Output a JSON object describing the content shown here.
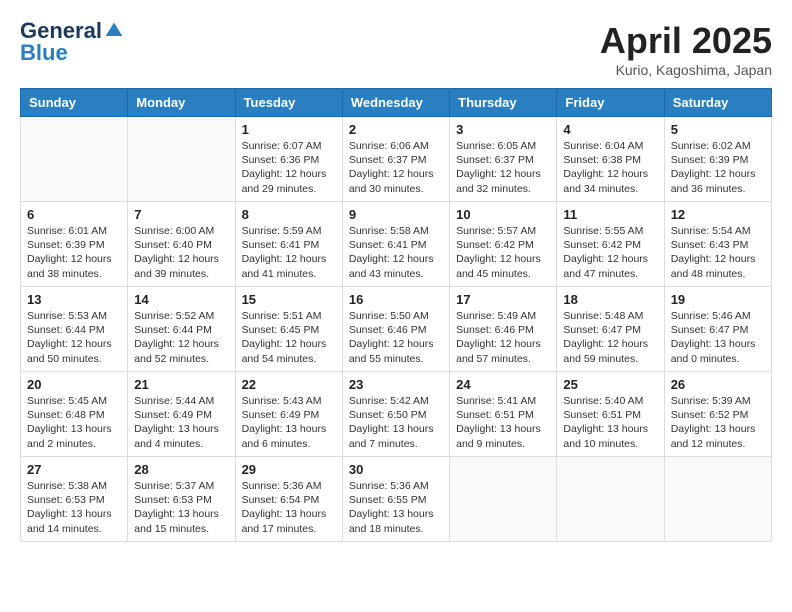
{
  "header": {
    "logo_general": "General",
    "logo_blue": "Blue",
    "month_title": "April 2025",
    "subtitle": "Kurio, Kagoshima, Japan"
  },
  "days_of_week": [
    "Sunday",
    "Monday",
    "Tuesday",
    "Wednesday",
    "Thursday",
    "Friday",
    "Saturday"
  ],
  "weeks": [
    [
      {
        "day": "",
        "info": ""
      },
      {
        "day": "",
        "info": ""
      },
      {
        "day": "1",
        "info": "Sunrise: 6:07 AM\nSunset: 6:36 PM\nDaylight: 12 hours\nand 29 minutes."
      },
      {
        "day": "2",
        "info": "Sunrise: 6:06 AM\nSunset: 6:37 PM\nDaylight: 12 hours\nand 30 minutes."
      },
      {
        "day": "3",
        "info": "Sunrise: 6:05 AM\nSunset: 6:37 PM\nDaylight: 12 hours\nand 32 minutes."
      },
      {
        "day": "4",
        "info": "Sunrise: 6:04 AM\nSunset: 6:38 PM\nDaylight: 12 hours\nand 34 minutes."
      },
      {
        "day": "5",
        "info": "Sunrise: 6:02 AM\nSunset: 6:39 PM\nDaylight: 12 hours\nand 36 minutes."
      }
    ],
    [
      {
        "day": "6",
        "info": "Sunrise: 6:01 AM\nSunset: 6:39 PM\nDaylight: 12 hours\nand 38 minutes."
      },
      {
        "day": "7",
        "info": "Sunrise: 6:00 AM\nSunset: 6:40 PM\nDaylight: 12 hours\nand 39 minutes."
      },
      {
        "day": "8",
        "info": "Sunrise: 5:59 AM\nSunset: 6:41 PM\nDaylight: 12 hours\nand 41 minutes."
      },
      {
        "day": "9",
        "info": "Sunrise: 5:58 AM\nSunset: 6:41 PM\nDaylight: 12 hours\nand 43 minutes."
      },
      {
        "day": "10",
        "info": "Sunrise: 5:57 AM\nSunset: 6:42 PM\nDaylight: 12 hours\nand 45 minutes."
      },
      {
        "day": "11",
        "info": "Sunrise: 5:55 AM\nSunset: 6:42 PM\nDaylight: 12 hours\nand 47 minutes."
      },
      {
        "day": "12",
        "info": "Sunrise: 5:54 AM\nSunset: 6:43 PM\nDaylight: 12 hours\nand 48 minutes."
      }
    ],
    [
      {
        "day": "13",
        "info": "Sunrise: 5:53 AM\nSunset: 6:44 PM\nDaylight: 12 hours\nand 50 minutes."
      },
      {
        "day": "14",
        "info": "Sunrise: 5:52 AM\nSunset: 6:44 PM\nDaylight: 12 hours\nand 52 minutes."
      },
      {
        "day": "15",
        "info": "Sunrise: 5:51 AM\nSunset: 6:45 PM\nDaylight: 12 hours\nand 54 minutes."
      },
      {
        "day": "16",
        "info": "Sunrise: 5:50 AM\nSunset: 6:46 PM\nDaylight: 12 hours\nand 55 minutes."
      },
      {
        "day": "17",
        "info": "Sunrise: 5:49 AM\nSunset: 6:46 PM\nDaylight: 12 hours\nand 57 minutes."
      },
      {
        "day": "18",
        "info": "Sunrise: 5:48 AM\nSunset: 6:47 PM\nDaylight: 12 hours\nand 59 minutes."
      },
      {
        "day": "19",
        "info": "Sunrise: 5:46 AM\nSunset: 6:47 PM\nDaylight: 13 hours\nand 0 minutes."
      }
    ],
    [
      {
        "day": "20",
        "info": "Sunrise: 5:45 AM\nSunset: 6:48 PM\nDaylight: 13 hours\nand 2 minutes."
      },
      {
        "day": "21",
        "info": "Sunrise: 5:44 AM\nSunset: 6:49 PM\nDaylight: 13 hours\nand 4 minutes."
      },
      {
        "day": "22",
        "info": "Sunrise: 5:43 AM\nSunset: 6:49 PM\nDaylight: 13 hours\nand 6 minutes."
      },
      {
        "day": "23",
        "info": "Sunrise: 5:42 AM\nSunset: 6:50 PM\nDaylight: 13 hours\nand 7 minutes."
      },
      {
        "day": "24",
        "info": "Sunrise: 5:41 AM\nSunset: 6:51 PM\nDaylight: 13 hours\nand 9 minutes."
      },
      {
        "day": "25",
        "info": "Sunrise: 5:40 AM\nSunset: 6:51 PM\nDaylight: 13 hours\nand 10 minutes."
      },
      {
        "day": "26",
        "info": "Sunrise: 5:39 AM\nSunset: 6:52 PM\nDaylight: 13 hours\nand 12 minutes."
      }
    ],
    [
      {
        "day": "27",
        "info": "Sunrise: 5:38 AM\nSunset: 6:53 PM\nDaylight: 13 hours\nand 14 minutes."
      },
      {
        "day": "28",
        "info": "Sunrise: 5:37 AM\nSunset: 6:53 PM\nDaylight: 13 hours\nand 15 minutes."
      },
      {
        "day": "29",
        "info": "Sunrise: 5:36 AM\nSunset: 6:54 PM\nDaylight: 13 hours\nand 17 minutes."
      },
      {
        "day": "30",
        "info": "Sunrise: 5:36 AM\nSunset: 6:55 PM\nDaylight: 13 hours\nand 18 minutes."
      },
      {
        "day": "",
        "info": ""
      },
      {
        "day": "",
        "info": ""
      },
      {
        "day": "",
        "info": ""
      }
    ]
  ]
}
